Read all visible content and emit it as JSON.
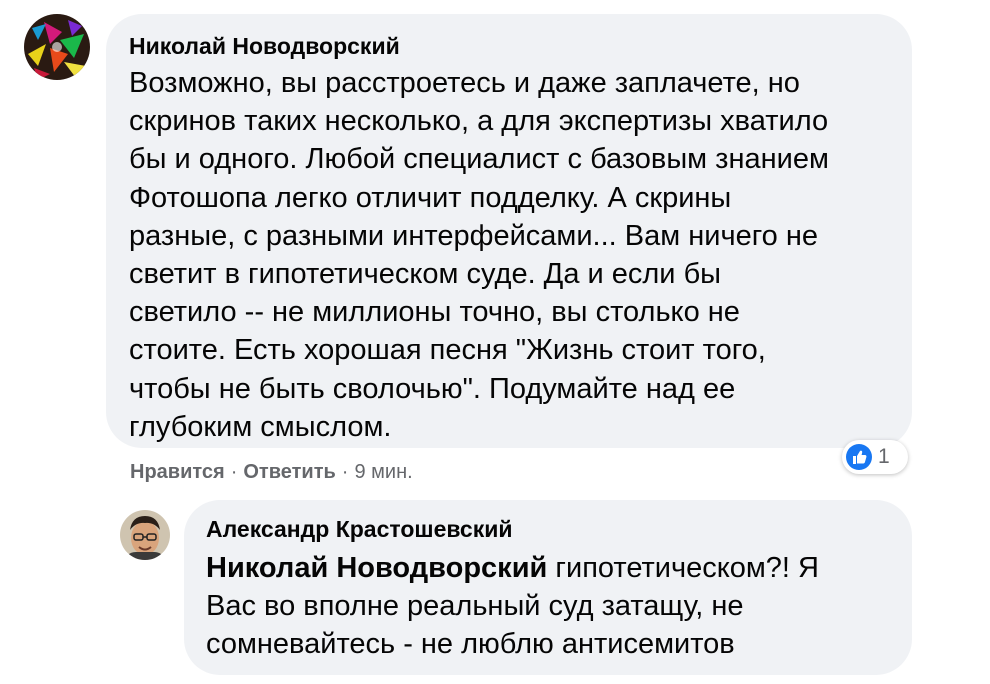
{
  "comments": [
    {
      "author": "Николай Новодворский",
      "lines": [
        "Возможно, вы расстроетесь и даже заплачете, но",
        "скринов таких несколько, а для экспертизы хватило",
        "бы и одного. Любой специалист с базовым знанием",
        "Фотошопа легко отличит подделку. А скрины",
        "разные, с разными интерфейсами... Вам ничего не",
        "светит в гипотетическом суде. Да и если бы",
        "светило -- не миллионы точно, вы столько не",
        "стоите. Есть хорошая песня \"Жизнь стоит того,",
        "чтобы не быть сволочью\". Подумайте над ее",
        "глубоким смыслом."
      ],
      "actions": {
        "like": "Нравится",
        "reply": "Ответить",
        "time": "9 мин."
      },
      "reaction": {
        "icon": "like-icon",
        "count": "1",
        "color": "#1877f2"
      }
    },
    {
      "author": "Александр Крастошевский",
      "mention": "Николай Новодворский",
      "lines": [
        " гипотетическом?! Я",
        "Вас во вполне реальный суд затащу, не",
        "сомневайтесь - не люблю антисемитов"
      ]
    }
  ],
  "colors": {
    "bubble": "#f0f2f5",
    "text": "#050505",
    "secondary": "#65676b",
    "accent": "#1877f2"
  }
}
